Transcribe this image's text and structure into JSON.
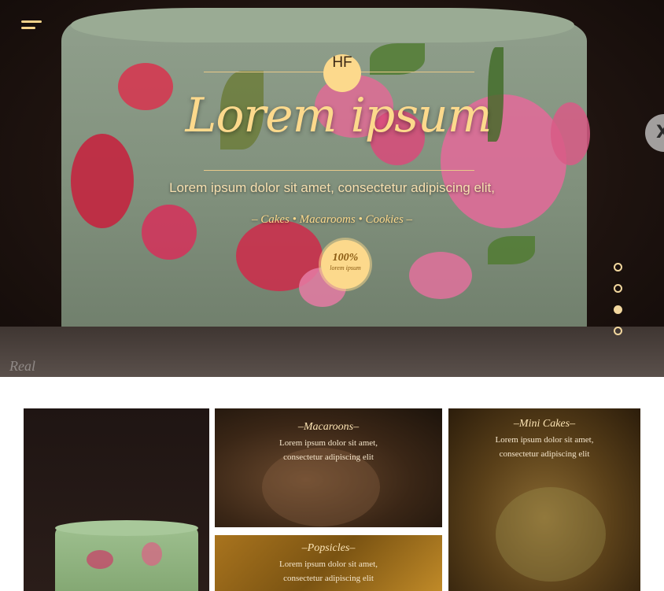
{
  "hero": {
    "logo": "HF",
    "title": "Lorem ipsum",
    "subtitle": "Lorem ipsum dolor sit amet, consectetur adipiscing elit,",
    "tagline": "– Cakes • Macarooms • Cookies –",
    "seal_value": "100%",
    "seal_label": "lorem ipsum",
    "signature": "Real",
    "next_icon": "X",
    "slider_active_index": 2,
    "slider_count": 4,
    "accent_color": "#fcd98c"
  },
  "icons": {
    "menu": "hamburger-menu-icon",
    "next": "next-slide-icon"
  },
  "gallery": {
    "macaroons": {
      "title": "–Macaroons–",
      "line1": "Lorem ipsum dolor sit amet,",
      "line2": "consectetur adipiscing elit"
    },
    "minicakes": {
      "title": "–Mini Cakes–",
      "line1": "Lorem ipsum dolor sit amet,",
      "line2": "consectetur adipiscing elit"
    },
    "popsicles": {
      "title": "–Popsicles–",
      "line1": "Lorem ipsum dolor sit amet,",
      "line2": "consectetur adipiscing elit"
    }
  }
}
